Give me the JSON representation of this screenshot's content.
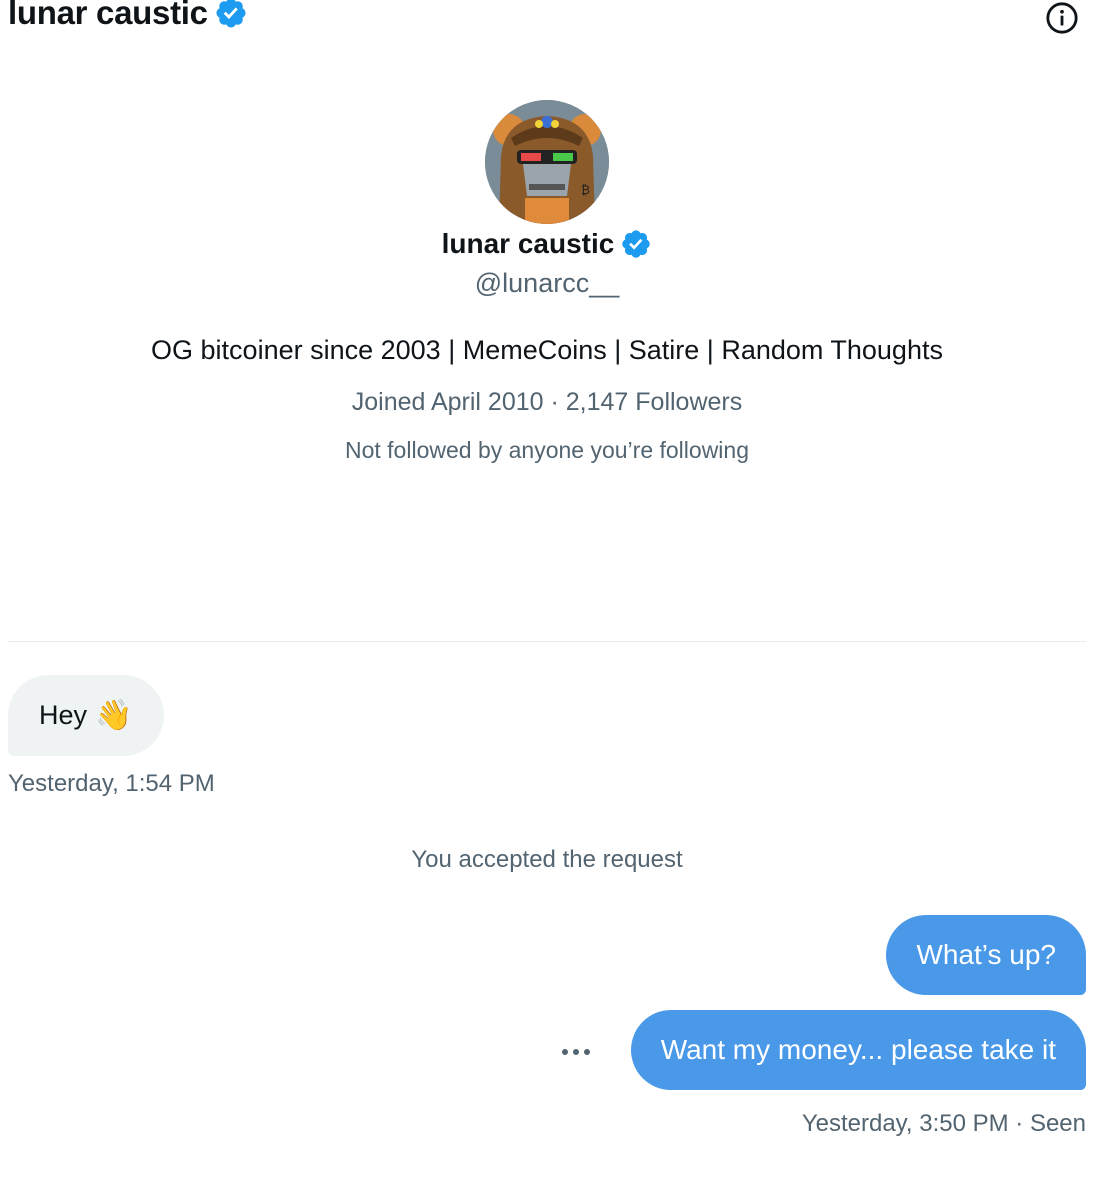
{
  "header": {
    "title": "lunar caustic",
    "verified_icon": "verified-badge-icon",
    "info_icon": "info-icon"
  },
  "profile": {
    "avatar": "profile-avatar",
    "display_name": "lunar caustic",
    "handle": "@lunarcc__",
    "bio": "OG bitcoiner since 2003 | MemeCoins | Satire | Random Thoughts",
    "meta": "Joined April 2010 · 2,147 Followers",
    "mutuals": "Not followed by anyone you’re following"
  },
  "messages": {
    "incoming": [
      {
        "text": "Hey",
        "emoji": "👋",
        "timestamp": "Yesterday, 1:54 PM"
      }
    ],
    "system": "You accepted the request",
    "outgoing": [
      {
        "text": "What’s up?"
      },
      {
        "text": "Want my money... please take it"
      }
    ],
    "outgoing_status": "Yesterday, 3:50 PM · Seen",
    "more_icon": "more-dots-icon"
  },
  "colors": {
    "accent": "#4a99e9",
    "verified": "#1d9bf0",
    "incoming_bubble": "#eff3f4",
    "secondary_text": "#536471"
  }
}
